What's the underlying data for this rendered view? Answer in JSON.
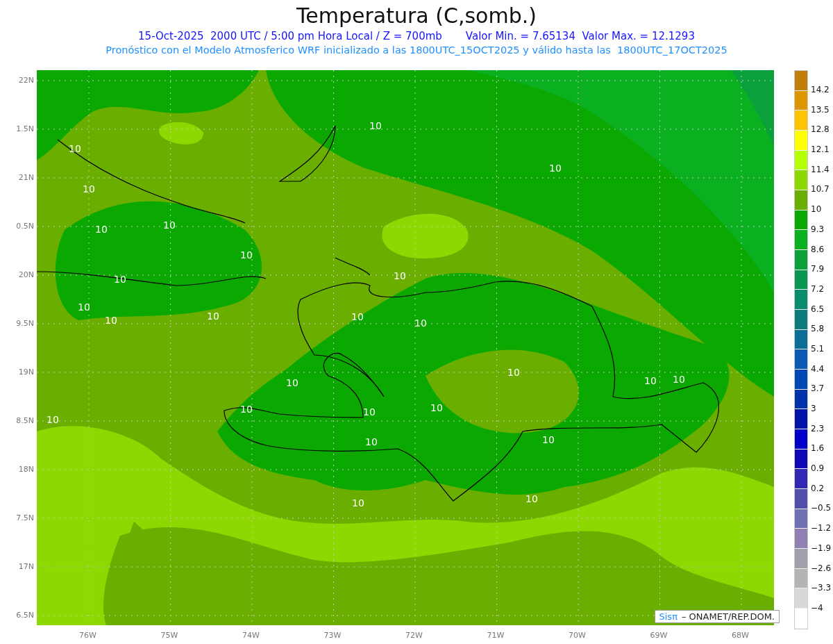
{
  "title": "Temperatura (C,somb.)",
  "subtitle": {
    "datetime": "15-Oct-2025  2000 UTC / 5:00 pm Hora Local / Z = 700mb",
    "range": "Valor Min. = 7.65134  Valor Max. = 12.1293"
  },
  "model_note": "Pronóstico con el Modelo Atmosferico WRF inicializado a las 1800UTC_15OCT2025 y válido hasta las  1800UTC_17OCT2025",
  "map": {
    "lat_ticks": [
      "22N",
      "1.5N",
      "21N",
      "0.5N",
      "20N",
      "9.5N",
      "19N",
      "8.5N",
      "18N",
      "7.5N",
      "17N",
      "6.5N"
    ],
    "lon_ticks": [
      "76W",
      "75W",
      "74W",
      "73W",
      "72W",
      "71W",
      "70W",
      "69W",
      "68W"
    ],
    "contour_labels": [
      "10",
      "10",
      "10",
      "10",
      "10",
      "10",
      "10",
      "10",
      "10",
      "10",
      "10",
      "10",
      "10",
      "10",
      "10",
      "10",
      "10",
      "10",
      "10",
      "10",
      "10",
      "10",
      "10",
      "10",
      "10",
      "10"
    ],
    "credit": {
      "logo": "Sisπ",
      "text": "– ONAMET/REP.DOM."
    }
  },
  "colorbar": {
    "labels": [
      "14.2",
      "13.5",
      "12.8",
      "12.1",
      "11.4",
      "10.7",
      "10",
      "9.3",
      "8.6",
      "7.9",
      "7.2",
      "6.5",
      "5.8",
      "5.1",
      "4.4",
      "3.7",
      "3",
      "2.3",
      "1.6",
      "0.9",
      "0.2",
      "−0.5",
      "−1.2",
      "−1.9",
      "−2.6",
      "−3.3",
      "−4"
    ]
  }
}
